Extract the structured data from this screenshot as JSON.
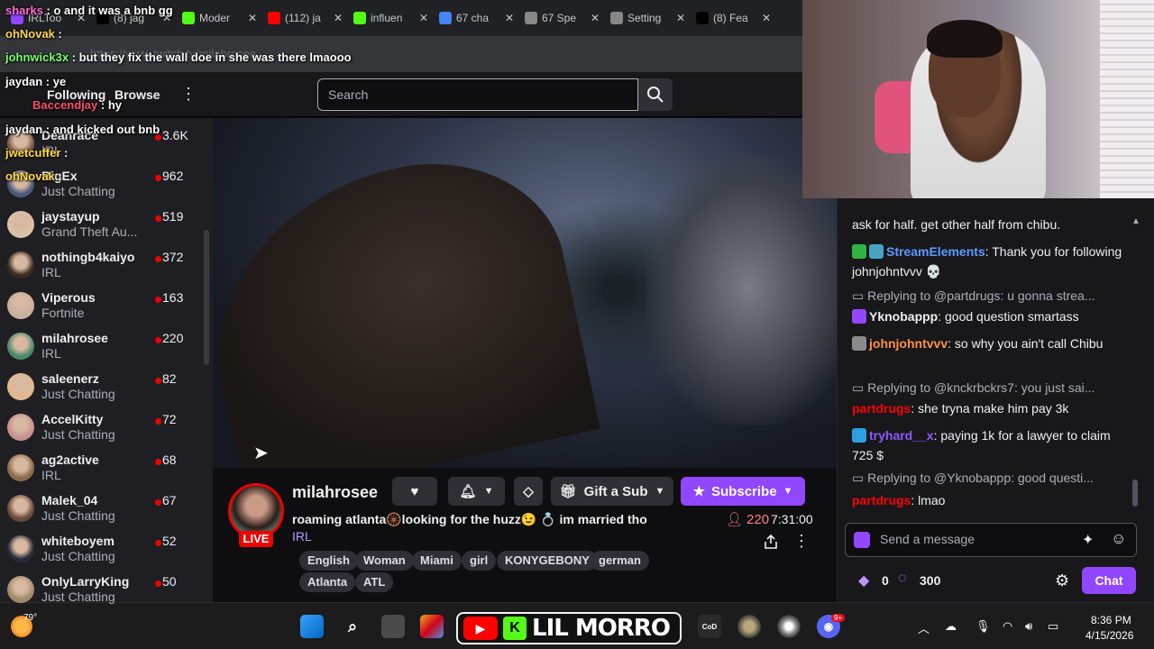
{
  "browser": {
    "tabs": [
      {
        "label": "IRLToo",
        "icon": "twitch-icon",
        "color": "#9146ff"
      },
      {
        "label": "(8) jag",
        "icon": "x-icon",
        "color": "#000000"
      },
      {
        "label": "Moder",
        "icon": "kick-icon",
        "color": "#53fc18"
      },
      {
        "label": "(112) ja",
        "icon": "youtube-icon",
        "color": "#ff0000"
      },
      {
        "label": "influen",
        "icon": "kick-icon",
        "color": "#53fc18"
      },
      {
        "label": "67 cha",
        "icon": "search-icon",
        "color": "#4285f4"
      },
      {
        "label": "67 Spe",
        "icon": "site-icon",
        "color": "#888888"
      },
      {
        "label": "Setting",
        "icon": "gear-icon",
        "color": "#888888"
      },
      {
        "label": "(8) Fea",
        "icon": "x-icon",
        "color": "#000000"
      }
    ],
    "url": "https://www.twitch.tv/milahrosee"
  },
  "header": {
    "following": "Following",
    "browse": "Browse",
    "search_placeholder": "Search"
  },
  "sidebar": {
    "channels": [
      {
        "name": "Deanrace",
        "category": "IRL",
        "viewers": "3.6K"
      },
      {
        "name": "BigEx",
        "category": "Just Chatting",
        "viewers": "962"
      },
      {
        "name": "jaystayup",
        "category": "Grand Theft Au...",
        "viewers": "519"
      },
      {
        "name": "nothingb4kaiyo",
        "category": "IRL",
        "viewers": "372"
      },
      {
        "name": "Viperous",
        "category": "Fortnite",
        "viewers": "163"
      },
      {
        "name": "milahrosee",
        "category": "IRL",
        "viewers": "220"
      },
      {
        "name": "saleenerz",
        "category": "Just Chatting",
        "viewers": "82"
      },
      {
        "name": "AccelKitty",
        "category": "Just Chatting",
        "viewers": "72"
      },
      {
        "name": "ag2active",
        "category": "IRL",
        "viewers": "68"
      },
      {
        "name": "Malek_04",
        "category": "Just Chatting",
        "viewers": "67"
      },
      {
        "name": "whiteboyem",
        "category": "Just Chatting",
        "viewers": "52"
      },
      {
        "name": "OnlyLarryKing",
        "category": "Just Chatting",
        "viewers": "50"
      }
    ]
  },
  "overlay_chat": [
    {
      "user": "sharks",
      "text": ": o and it was a bnb gg",
      "color": "#ff6ad5"
    },
    {
      "user": "ohNovak",
      "text": ":",
      "color": "#ffd84a"
    },
    {
      "user": "johnwick3x",
      "text": ": but they fix the wall doe in she was there lmaooo",
      "color": "#7cff6b"
    },
    {
      "user": "jaydan",
      "text": ": ye",
      "color": "#ffffff"
    },
    {
      "user": "Baccendjay",
      "text": ": hy",
      "color": "#ff4d6d"
    },
    {
      "user": "jaydan",
      "text": ": and kicked out bnb",
      "color": "#ffffff"
    },
    {
      "user": "jwetcuffer",
      "text": ":",
      "color": "#ffd84a"
    },
    {
      "user": "ohNovak",
      "text": ":",
      "color": "#ffd84a"
    }
  ],
  "stream": {
    "channel": "milahrosee",
    "live": "LIVE",
    "title": "roaming atlanta🛞looking for the huzz😉 💍 im married tho",
    "category": "IRL",
    "viewers": "220",
    "uptime": "7:31:00",
    "gift_label": "Gift a Sub",
    "subscribe_label": "Subscribe",
    "tags": [
      "English",
      "Woman",
      "Miami",
      "girl",
      "KONYGEBONY",
      "german",
      "Atlanta",
      "ATL"
    ]
  },
  "chat": {
    "messages": [
      {
        "type": "msg",
        "user": "",
        "text": "ask for half. get other half from chibu.",
        "color": "#efeff1"
      },
      {
        "type": "msg",
        "user": "StreamElements",
        "text": ": Thank you for following johnjohntvvv 💀",
        "color": "#5c9cff"
      },
      {
        "type": "reply",
        "text": "Replying to @partdrugs: u gonna strea..."
      },
      {
        "type": "msg",
        "user": "Yknobappp",
        "text": ": good question smartass",
        "color": "#efeff1"
      },
      {
        "type": "msg",
        "user": "johnjohntvvv",
        "text": ": so why you ain't call Chibu",
        "color": "#ff9147"
      },
      {
        "type": "reply",
        "text": "Replying to @knckrbckrs7: you just sai..."
      },
      {
        "type": "msg",
        "user": "partdrugs",
        "text": ": she tryna make him pay 3k",
        "color": "#ff0000"
      },
      {
        "type": "msg",
        "user": "tryhard__x",
        "text": ": paying 1k for a lawyer to claim 725 $",
        "color": "#8a5cff"
      },
      {
        "type": "reply",
        "text": "Replying to @Yknobappp: good questi..."
      },
      {
        "type": "msg",
        "user": "partdrugs",
        "text": ": lmao",
        "color": "#ff0000"
      }
    ],
    "placeholder": "Send a message",
    "points_a": "0",
    "points_b": "300",
    "chat_button": "Chat"
  },
  "taskbar": {
    "temp": "79°",
    "overlay_logo": "LIL MORRO",
    "time": "8:36 PM",
    "date": "4/15/2026",
    "notif_badge": "9+"
  }
}
